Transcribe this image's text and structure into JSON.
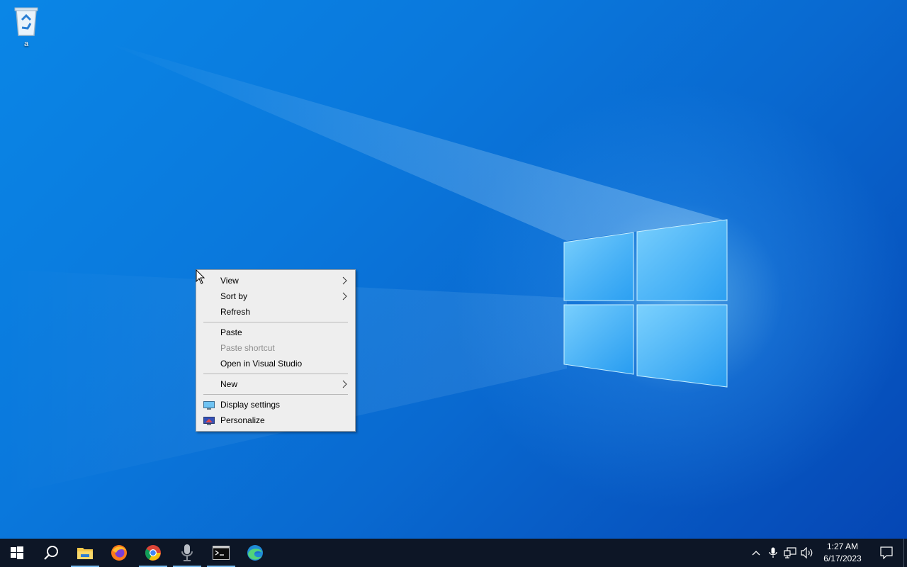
{
  "desktop": {
    "icons": [
      {
        "label": "a",
        "icon": "recycle-bin-icon"
      }
    ]
  },
  "context_menu": {
    "items": [
      {
        "label": "View",
        "submenu": true
      },
      {
        "label": "Sort by",
        "submenu": true
      },
      {
        "label": "Refresh"
      },
      {
        "label": "Paste"
      },
      {
        "label": "Paste shortcut",
        "disabled": true
      },
      {
        "label": "Open in Visual Studio"
      },
      {
        "label": "New",
        "submenu": true
      },
      {
        "label": "Display settings",
        "icon": "display-settings-icon"
      },
      {
        "label": "Personalize",
        "icon": "personalize-icon"
      }
    ]
  },
  "taskbar": {
    "start_icon": "windows-start-icon",
    "search_icon": "search-icon",
    "apps": [
      {
        "icon": "file-explorer-icon",
        "running": true
      },
      {
        "icon": "firefox-icon",
        "running": false
      },
      {
        "icon": "chrome-icon",
        "running": true
      },
      {
        "icon": "microphone-app-icon",
        "running": true
      },
      {
        "icon": "terminal-icon",
        "running": true
      },
      {
        "icon": "edge-icon",
        "running": false
      }
    ],
    "tray": {
      "icons": [
        "chevron-up-icon",
        "microphone-icon",
        "network-icon",
        "volume-icon"
      ],
      "time": "1:27 AM",
      "date": "6/17/2023",
      "notification_icon": "notification-icon"
    }
  },
  "colors": {
    "desktop_accent": "#0a78dc",
    "taskbar_bg": "#0d1626",
    "menu_bg": "#eeeeee",
    "running_indicator": "#76b9ed"
  }
}
